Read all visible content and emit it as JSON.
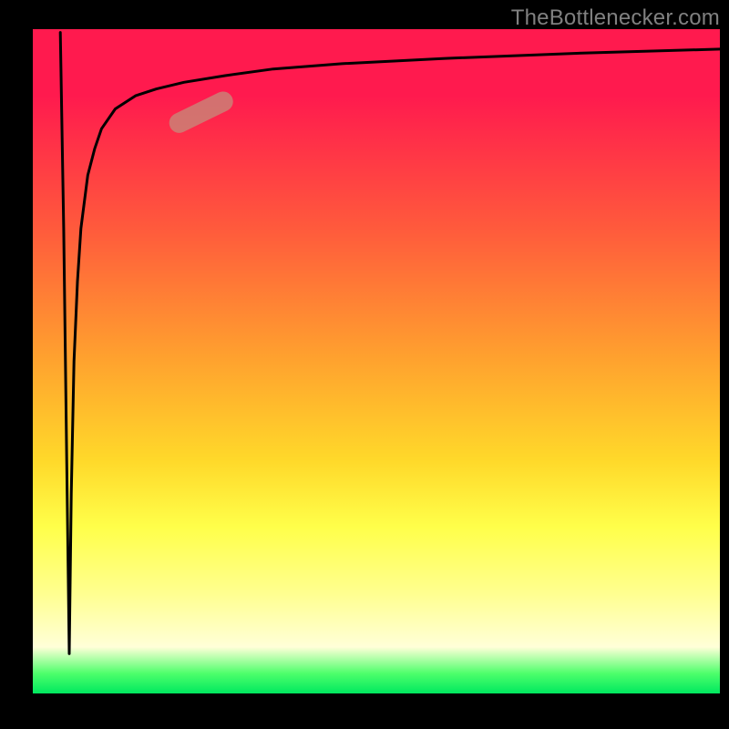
{
  "attribution": "TheBottlenecker.com",
  "colors": {
    "background": "#000000",
    "attribution_text": "#808080",
    "gradient_top": "#ff1a4e",
    "gradient_mid1": "#ffa32e",
    "gradient_mid2": "#ffff4a",
    "gradient_bottom": "#00e85f",
    "curve": "#000000",
    "highlight_blob": "#c6897a"
  },
  "chart_data": {
    "type": "line",
    "title": "",
    "xlabel": "",
    "ylabel": "",
    "xlim": [
      0,
      100
    ],
    "ylim": [
      0,
      100
    ],
    "series": [
      {
        "name": "bottleneck-curve",
        "comment": "y read as percent-from-top of the plot area; lower y = closer to top edge",
        "x": [
          4.0,
          4.5,
          5.0,
          5.3,
          5.6,
          6.0,
          6.5,
          7.0,
          8.0,
          9.0,
          10.0,
          12.0,
          15.0,
          18.0,
          22.0,
          28.0,
          35.0,
          45.0,
          60.0,
          80.0,
          100.0
        ],
        "y": [
          0.5,
          30.0,
          70.0,
          94.0,
          70.0,
          50.0,
          38.0,
          30.0,
          22.0,
          18.0,
          15.0,
          12.0,
          10.0,
          9.0,
          8.0,
          7.0,
          6.0,
          5.2,
          4.4,
          3.6,
          3.0
        ]
      }
    ],
    "annotations": [
      {
        "name": "highlight-blob",
        "shape": "rounded-pill",
        "x_center_pct": 24.5,
        "y_center_pct": 12.5,
        "length_pct": 10.0,
        "thickness_pct": 3.0,
        "angle_deg": -26
      }
    ]
  }
}
